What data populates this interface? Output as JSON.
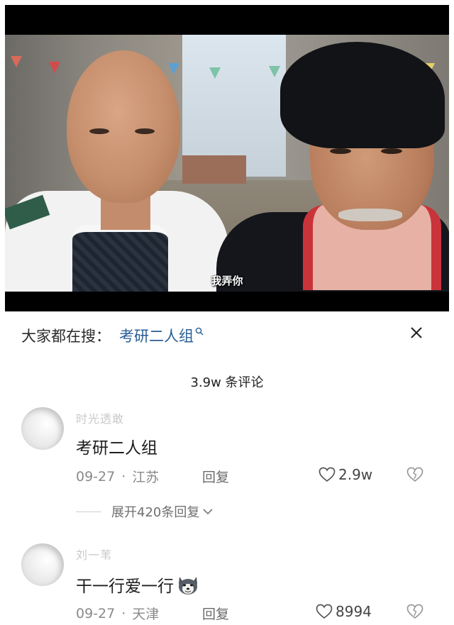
{
  "video": {
    "subtitle": "我弄你"
  },
  "search": {
    "prefix": "大家都在搜：",
    "term": "考研二人组",
    "term_icon": "search-icon",
    "close_icon": "close-icon",
    "accent_color": "#275e96"
  },
  "comments_header": {
    "count_label": "3.9w 条评论"
  },
  "comments": [
    {
      "username": "时光透敢",
      "text": "考研二人组",
      "date": "09-27",
      "location": "江苏",
      "reply_label": "回复",
      "likes": "2.9w",
      "expand_label": "展开420条回复"
    },
    {
      "username": "刘一苇",
      "text": "干一行爱一行",
      "emoji": "husky-emoji",
      "date": "09-27",
      "location": "天津",
      "reply_label": "回复",
      "likes": "8994"
    }
  ]
}
